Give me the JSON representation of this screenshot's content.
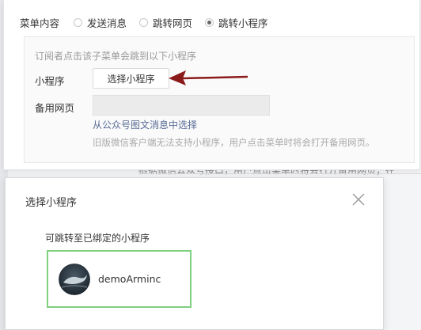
{
  "background": {
    "partial_text": "根据微信公众号接口，用户点击菜单时将会打开备用网页；在"
  },
  "menu_content": {
    "label": "菜单内容",
    "options": [
      {
        "label": "发送消息",
        "checked": false
      },
      {
        "label": "跳转网页",
        "checked": false
      },
      {
        "label": "跳转小程序",
        "checked": true
      }
    ],
    "hint": "订阅者点击该子菜单会跳到以下小程序",
    "mini_program_label": "小程序",
    "select_button": "选择小程序",
    "backup_label": "备用网页",
    "backup_value": "",
    "link_text": "从公众号图文消息中选择",
    "note": "旧版微信客户端无法支持小程序，用户点击菜单时将会打开备用网页。"
  },
  "annotation": {
    "arrow_color": "#8b1a1a"
  },
  "dialog": {
    "title": "选择小程序",
    "subtitle": "可跳转至已绑定的小程序",
    "mini_program": {
      "name": "demoArminc",
      "selected": true
    },
    "selected_border_color": "#7fd07f"
  }
}
